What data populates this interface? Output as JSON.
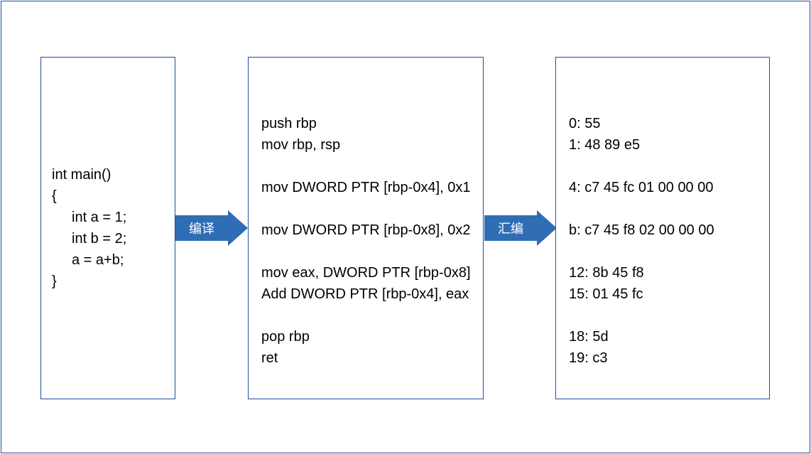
{
  "arrows": {
    "compile": "编译",
    "assemble": "汇编"
  },
  "source": {
    "l1": "int main()",
    "l2": "{",
    "l3": "int a = 1;",
    "l4": "int b = 2;",
    "l5": "a = a+b;",
    "l6": "}"
  },
  "asm": {
    "l1": "push rbp",
    "l2": "mov rbp, rsp",
    "l3": "mov DWORD PTR [rbp-0x4], 0x1",
    "l4": "mov DWORD PTR [rbp-0x8], 0x2",
    "l5": "mov eax, DWORD PTR [rbp-0x8]",
    "l6": "Add DWORD PTR [rbp-0x4], eax",
    "l7": "pop rbp",
    "l8": "ret"
  },
  "hex": {
    "l1": "0: 55",
    "l2": "1: 48 89 e5",
    "l3": "4: c7 45 fc 01 00 00 00",
    "l4": "b: c7 45 f8 02 00 00 00",
    "l5": "12: 8b 45 f8",
    "l6": "15: 01 45 fc",
    "l7": "18: 5d",
    "l8": "19: c3"
  }
}
